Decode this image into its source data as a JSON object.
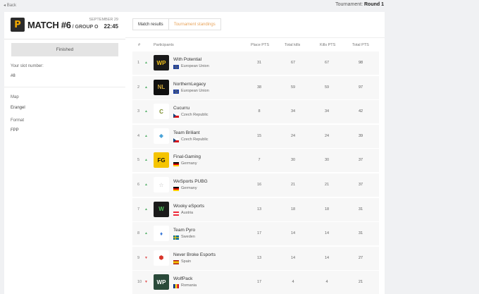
{
  "nav": {
    "back_label": "Back"
  },
  "header": {
    "tournament_label": "Tournament:",
    "tournament_value": "Round 1"
  },
  "match": {
    "logo_letter": "P",
    "title": "MATCH #6",
    "group": "/ GROUP O",
    "date": "SEPTEMBER 29",
    "time": "22:45",
    "status": "Finished",
    "slot_label": "Your slot number:",
    "slot_value": "#8",
    "map_label": "Map",
    "map_value": "Erangel",
    "format_label": "Format",
    "format_value": "FPP"
  },
  "tabs": [
    "Match results",
    "Tournament standings"
  ],
  "columns": [
    "#",
    "Participants",
    "Place PTS",
    "Total kills",
    "Kills PTS",
    "Total PTS"
  ],
  "teams": [
    {
      "rank": "1",
      "name": "With Potential",
      "country": "European Union",
      "place_pts": "31",
      "total_kills": "67",
      "kills_pts": "67",
      "total_pts": "98",
      "logo_bg": "#1a1a1a",
      "logo_fg": "#f2c21b",
      "logo_text": "WP",
      "flag": "eu",
      "trend": "up"
    },
    {
      "rank": "2",
      "name": "NorthernLegacy",
      "country": "European Union",
      "place_pts": "38",
      "total_kills": "59",
      "kills_pts": "59",
      "total_pts": "97",
      "logo_bg": "#111111",
      "logo_fg": "#c9a43a",
      "logo_text": "NL",
      "flag": "eu",
      "trend": "up"
    },
    {
      "rank": "3",
      "name": "Cucurru",
      "country": "Czech Republic",
      "place_pts": "8",
      "total_kills": "34",
      "kills_pts": "34",
      "total_pts": "42",
      "logo_bg": "#ffffff",
      "logo_fg": "#7a8c2a",
      "logo_text": "C",
      "flag": "cz",
      "trend": "up"
    },
    {
      "rank": "4",
      "name": "Team Briliant",
      "country": "Czech Republic",
      "place_pts": "15",
      "total_kills": "24",
      "kills_pts": "24",
      "total_pts": "39",
      "logo_bg": "#ffffff",
      "logo_fg": "#4aa3d8",
      "logo_text": "◆",
      "flag": "cz",
      "trend": "up"
    },
    {
      "rank": "5",
      "name": "Final-Gaming",
      "country": "Germany",
      "place_pts": "7",
      "total_kills": "30",
      "kills_pts": "30",
      "total_pts": "37",
      "logo_bg": "#f5c400",
      "logo_fg": "#111111",
      "logo_text": "FG",
      "flag": "de",
      "trend": "up"
    },
    {
      "rank": "6",
      "name": "WeSports PUBG",
      "country": "Germany",
      "place_pts": "16",
      "total_kills": "21",
      "kills_pts": "21",
      "total_pts": "37",
      "logo_bg": "#ffffff",
      "logo_fg": "#bbbbbb",
      "logo_text": "☆",
      "flag": "de",
      "trend": "up"
    },
    {
      "rank": "7",
      "name": "Wooky eSports",
      "country": "Austria",
      "place_pts": "13",
      "total_kills": "18",
      "kills_pts": "18",
      "total_pts": "31",
      "logo_bg": "#1a1a1a",
      "logo_fg": "#4fbf5a",
      "logo_text": "W",
      "flag": "at",
      "trend": "up"
    },
    {
      "rank": "8",
      "name": "Team Pyro",
      "country": "Sweden",
      "place_pts": "17",
      "total_kills": "14",
      "kills_pts": "14",
      "total_pts": "31",
      "logo_bg": "#ffffff",
      "logo_fg": "#3a78d8",
      "logo_text": "♦",
      "flag": "se",
      "trend": "up"
    },
    {
      "rank": "9",
      "name": "Never Broke Esports",
      "country": "Spain",
      "place_pts": "13",
      "total_kills": "14",
      "kills_pts": "14",
      "total_pts": "27",
      "logo_bg": "#ffffff",
      "logo_fg": "#d8352a",
      "logo_text": "⬢",
      "flag": "es",
      "trend": "down"
    },
    {
      "rank": "10",
      "name": "WolfPack",
      "country": "Romania",
      "place_pts": "17",
      "total_kills": "4",
      "kills_pts": "4",
      "total_pts": "21",
      "logo_bg": "#2a4a3a",
      "logo_fg": "#ffffff",
      "logo_text": "WP",
      "flag": "ro",
      "trend": "down"
    }
  ],
  "colors": {
    "accent": "#e8a35a",
    "up": "#56b06a",
    "down": "#e05252",
    "row_bg": "#f7f7f7"
  },
  "icons": {
    "back": "arrow-left-icon",
    "up": "caret-up-icon",
    "down": "caret-down-icon"
  }
}
